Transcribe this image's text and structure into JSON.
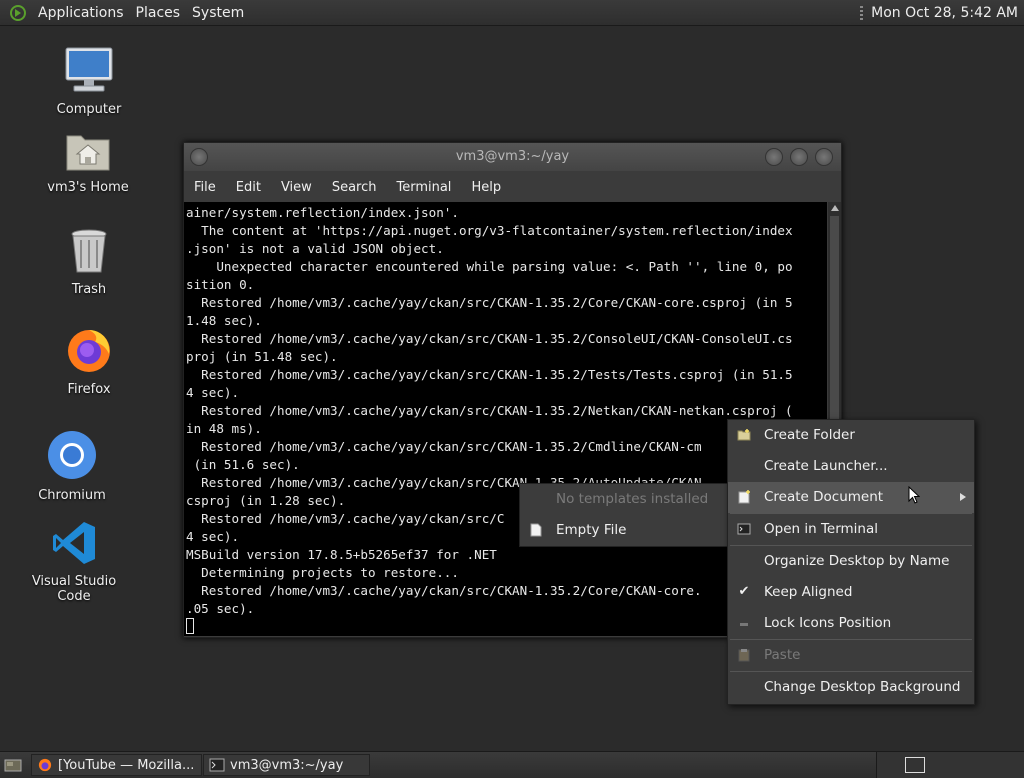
{
  "top_panel": {
    "menus": [
      "Applications",
      "Places",
      "System"
    ],
    "clock": "Mon Oct 28,  5:42 AM"
  },
  "desktop_icons": [
    {
      "label": "Computer",
      "icon": "computer-icon"
    },
    {
      "label": "vm3's Home",
      "icon": "home-folder-icon"
    },
    {
      "label": "Trash",
      "icon": "trash-icon"
    },
    {
      "label": "Firefox",
      "icon": "firefox-icon"
    },
    {
      "label": "Chromium",
      "icon": "chromium-icon"
    },
    {
      "label": "Visual Studio Code",
      "icon": "vscode-icon"
    }
  ],
  "terminal": {
    "title": "vm3@vm3:~/yay",
    "menu": [
      "File",
      "Edit",
      "View",
      "Search",
      "Terminal",
      "Help"
    ],
    "lines": [
      "ainer/system.reflection/index.json'.",
      "  The content at 'https://api.nuget.org/v3-flatcontainer/system.reflection/index",
      ".json' is not a valid JSON object.",
      "    Unexpected character encountered while parsing value: <. Path '', line 0, po",
      "sition 0.",
      "  Restored /home/vm3/.cache/yay/ckan/src/CKAN-1.35.2/Core/CKAN-core.csproj (in 5",
      "1.48 sec).",
      "  Restored /home/vm3/.cache/yay/ckan/src/CKAN-1.35.2/ConsoleUI/CKAN-ConsoleUI.cs",
      "proj (in 51.48 sec).",
      "  Restored /home/vm3/.cache/yay/ckan/src/CKAN-1.35.2/Tests/Tests.csproj (in 51.5",
      "4 sec).",
      "  Restored /home/vm3/.cache/yay/ckan/src/CKAN-1.35.2/Netkan/CKAN-netkan.csproj (",
      "in 48 ms).",
      "  Restored /home/vm3/.cache/yay/ckan/src/CKAN-1.35.2/Cmdline/CKAN-cm",
      " (in 51.6 sec).",
      "  Restored /home/vm3/.cache/yay/ckan/src/CKAN-1.35.2/AutoUpdate/CKAN",
      "csproj (in 1.28 sec).",
      "  Restored /home/vm3/.cache/yay/ckan/src/C",
      "4 sec).",
      "MSBuild version 17.8.5+b5265ef37 for .NET",
      "  Determining projects to restore...",
      "  Restored /home/vm3/.cache/yay/ckan/src/CKAN-1.35.2/Core/CKAN-core.",
      ".05 sec)."
    ]
  },
  "submenu": {
    "header": "No templates installed",
    "items": [
      {
        "label": "Empty File",
        "icon": "file-icon"
      }
    ]
  },
  "context_menu": {
    "items": [
      {
        "label": "Create Folder",
        "icon": "new-folder-icon"
      },
      {
        "label": "Create Launcher...",
        "icon": ""
      },
      {
        "label": "Create Document",
        "icon": "new-document-icon"
      },
      {
        "label": "Open in Terminal",
        "icon": "terminal-icon"
      },
      {
        "label": "Organize Desktop by Name",
        "icon": ""
      },
      {
        "label": "Keep Aligned",
        "icon": "checkmark-icon"
      },
      {
        "label": "Lock Icons Position",
        "icon": "lock-icon"
      },
      {
        "label": "Paste",
        "icon": "paste-icon"
      },
      {
        "label": "Change Desktop Background",
        "icon": ""
      }
    ]
  },
  "taskbar": {
    "tasks": [
      {
        "label": "[YouTube — Mozilla...",
        "icon": "firefox-icon"
      },
      {
        "label": "vm3@vm3:~/yay",
        "icon": "terminal-icon"
      }
    ]
  }
}
